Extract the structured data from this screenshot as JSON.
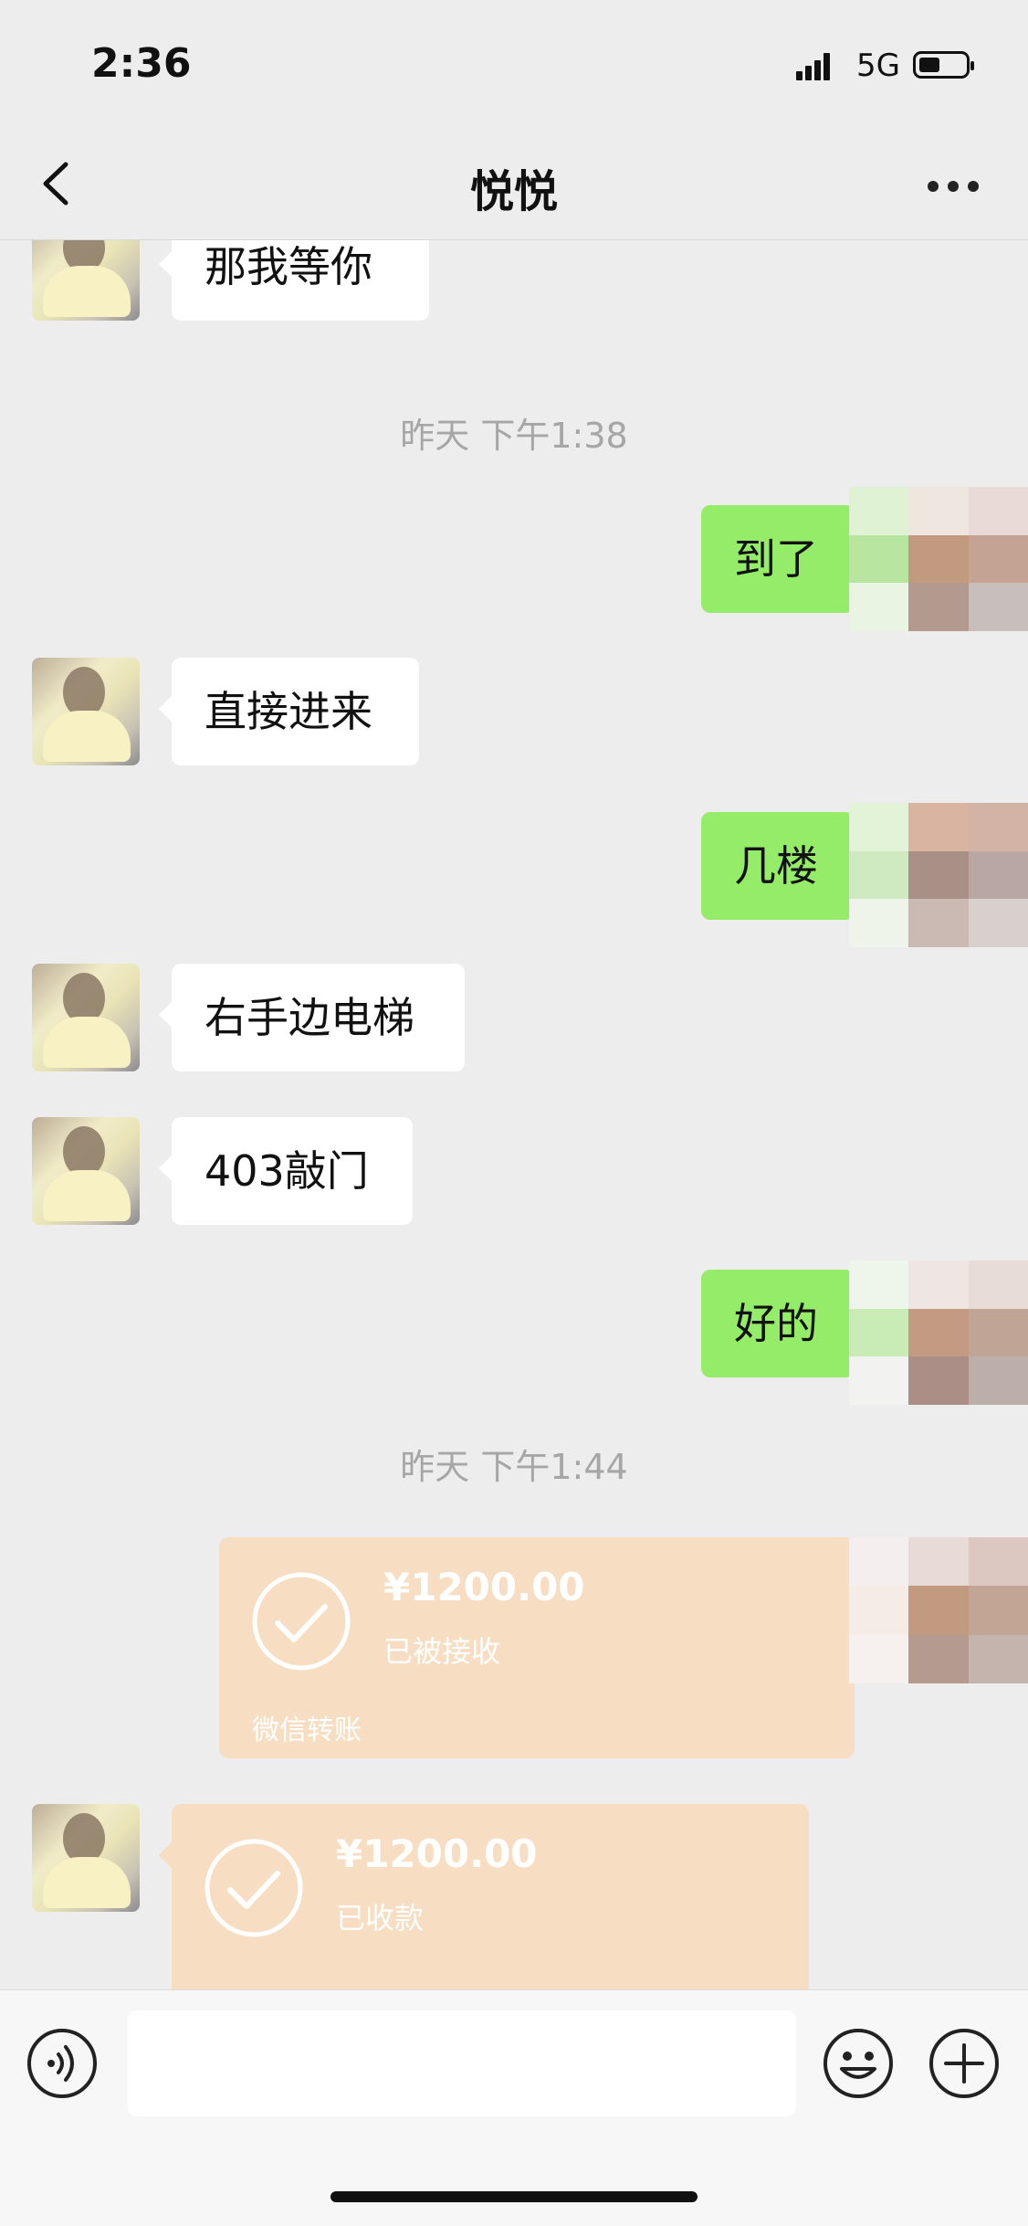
{
  "status_bar": {
    "time": "2:36",
    "network": "5G",
    "battery_level": 0.45
  },
  "header": {
    "title": "悦悦",
    "back_icon": "chevron-left-icon",
    "more_icon": "more-dots-icon"
  },
  "messages": {
    "m1": "那我等你",
    "ts1": "昨天 下午1:38",
    "m2": "到了",
    "m3": "直接进来",
    "m4": "几楼",
    "m5": "右手边电梯",
    "m6": "403敲门",
    "m7": "好的",
    "ts2": "昨天 下午1:44"
  },
  "transfers": {
    "t1": {
      "amount": "¥1200.00",
      "status": "已被接收",
      "footer": "微信转账"
    },
    "t2": {
      "amount": "¥1200.00",
      "status": "已收款"
    }
  },
  "colors": {
    "background": "#ededed",
    "outgoing_bubble": "#95ec69",
    "incoming_bubble": "#ffffff",
    "transfer_card": "#f7dec2"
  },
  "input_bar": {
    "voice_icon": "voice-icon",
    "emoji_icon": "emoji-icon",
    "plus_icon": "plus-icon",
    "input_value": ""
  }
}
